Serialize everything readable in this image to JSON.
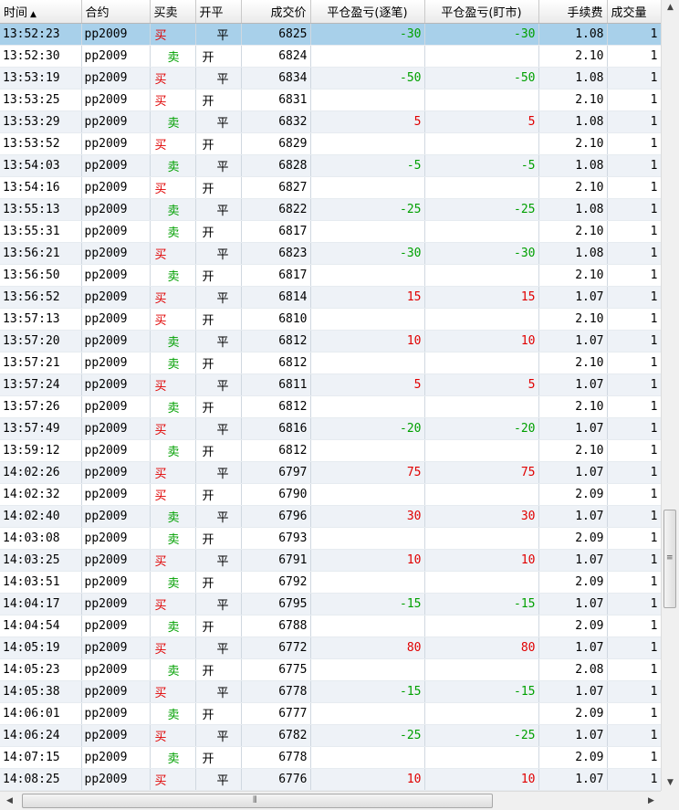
{
  "columns": [
    {
      "key": "time",
      "label": "时间",
      "sort_arrow": "▲",
      "align": "l"
    },
    {
      "key": "contract",
      "label": "合约",
      "align": "l"
    },
    {
      "key": "side",
      "label": "买卖",
      "align": "l"
    },
    {
      "key": "oc",
      "label": "开平",
      "align": "l"
    },
    {
      "key": "price",
      "label": "成交价",
      "align": "r"
    },
    {
      "key": "pnl_trade",
      "label": "平仓盈亏(逐笔)",
      "align": "c"
    },
    {
      "key": "pnl_mark",
      "label": "平仓盈亏(盯市)",
      "align": "c"
    },
    {
      "key": "fee",
      "label": "手续费",
      "align": "r"
    },
    {
      "key": "volume",
      "label": "成交量",
      "align": "l"
    }
  ],
  "colors": {
    "buy": "#e00000",
    "sell": "#00a000",
    "selected_row": "#a8d0ea"
  },
  "icons": {
    "sort": "sort-ascending-icon",
    "scroll_up": "arrow-up-icon",
    "scroll_down": "arrow-down-icon",
    "scroll_left": "arrow-left-icon",
    "scroll_right": "arrow-right-icon"
  },
  "scrollbar_glyphs": {
    "up": "▲",
    "down": "▼",
    "left": "◀",
    "right": "▶",
    "v_grip": "≡",
    "h_grip": "⦀"
  },
  "selected_index": 0,
  "rows": [
    {
      "time": "13:52:23",
      "contract": "pp2009",
      "side": "买",
      "oc": "平",
      "price": "6825",
      "pnl_trade": "-30",
      "pnl_mark": "-30",
      "fee": "1.08",
      "volume": "1"
    },
    {
      "time": "13:52:30",
      "contract": "pp2009",
      "side": "卖",
      "oc": "开",
      "price": "6824",
      "pnl_trade": "",
      "pnl_mark": "",
      "fee": "2.10",
      "volume": "1"
    },
    {
      "time": "13:53:19",
      "contract": "pp2009",
      "side": "买",
      "oc": "平",
      "price": "6834",
      "pnl_trade": "-50",
      "pnl_mark": "-50",
      "fee": "1.08",
      "volume": "1"
    },
    {
      "time": "13:53:25",
      "contract": "pp2009",
      "side": "买",
      "oc": "开",
      "price": "6831",
      "pnl_trade": "",
      "pnl_mark": "",
      "fee": "2.10",
      "volume": "1"
    },
    {
      "time": "13:53:29",
      "contract": "pp2009",
      "side": "卖",
      "oc": "平",
      "price": "6832",
      "pnl_trade": "5",
      "pnl_mark": "5",
      "fee": "1.08",
      "volume": "1"
    },
    {
      "time": "13:53:52",
      "contract": "pp2009",
      "side": "买",
      "oc": "开",
      "price": "6829",
      "pnl_trade": "",
      "pnl_mark": "",
      "fee": "2.10",
      "volume": "1"
    },
    {
      "time": "13:54:03",
      "contract": "pp2009",
      "side": "卖",
      "oc": "平",
      "price": "6828",
      "pnl_trade": "-5",
      "pnl_mark": "-5",
      "fee": "1.08",
      "volume": "1"
    },
    {
      "time": "13:54:16",
      "contract": "pp2009",
      "side": "买",
      "oc": "开",
      "price": "6827",
      "pnl_trade": "",
      "pnl_mark": "",
      "fee": "2.10",
      "volume": "1"
    },
    {
      "time": "13:55:13",
      "contract": "pp2009",
      "side": "卖",
      "oc": "平",
      "price": "6822",
      "pnl_trade": "-25",
      "pnl_mark": "-25",
      "fee": "1.08",
      "volume": "1"
    },
    {
      "time": "13:55:31",
      "contract": "pp2009",
      "side": "卖",
      "oc": "开",
      "price": "6817",
      "pnl_trade": "",
      "pnl_mark": "",
      "fee": "2.10",
      "volume": "1"
    },
    {
      "time": "13:56:21",
      "contract": "pp2009",
      "side": "买",
      "oc": "平",
      "price": "6823",
      "pnl_trade": "-30",
      "pnl_mark": "-30",
      "fee": "1.08",
      "volume": "1"
    },
    {
      "time": "13:56:50",
      "contract": "pp2009",
      "side": "卖",
      "oc": "开",
      "price": "6817",
      "pnl_trade": "",
      "pnl_mark": "",
      "fee": "2.10",
      "volume": "1"
    },
    {
      "time": "13:56:52",
      "contract": "pp2009",
      "side": "买",
      "oc": "平",
      "price": "6814",
      "pnl_trade": "15",
      "pnl_mark": "15",
      "fee": "1.07",
      "volume": "1"
    },
    {
      "time": "13:57:13",
      "contract": "pp2009",
      "side": "买",
      "oc": "开",
      "price": "6810",
      "pnl_trade": "",
      "pnl_mark": "",
      "fee": "2.10",
      "volume": "1"
    },
    {
      "time": "13:57:20",
      "contract": "pp2009",
      "side": "卖",
      "oc": "平",
      "price": "6812",
      "pnl_trade": "10",
      "pnl_mark": "10",
      "fee": "1.07",
      "volume": "1"
    },
    {
      "time": "13:57:21",
      "contract": "pp2009",
      "side": "卖",
      "oc": "开",
      "price": "6812",
      "pnl_trade": "",
      "pnl_mark": "",
      "fee": "2.10",
      "volume": "1"
    },
    {
      "time": "13:57:24",
      "contract": "pp2009",
      "side": "买",
      "oc": "平",
      "price": "6811",
      "pnl_trade": "5",
      "pnl_mark": "5",
      "fee": "1.07",
      "volume": "1"
    },
    {
      "time": "13:57:26",
      "contract": "pp2009",
      "side": "卖",
      "oc": "开",
      "price": "6812",
      "pnl_trade": "",
      "pnl_mark": "",
      "fee": "2.10",
      "volume": "1"
    },
    {
      "time": "13:57:49",
      "contract": "pp2009",
      "side": "买",
      "oc": "平",
      "price": "6816",
      "pnl_trade": "-20",
      "pnl_mark": "-20",
      "fee": "1.07",
      "volume": "1"
    },
    {
      "time": "13:59:12",
      "contract": "pp2009",
      "side": "卖",
      "oc": "开",
      "price": "6812",
      "pnl_trade": "",
      "pnl_mark": "",
      "fee": "2.10",
      "volume": "1"
    },
    {
      "time": "14:02:26",
      "contract": "pp2009",
      "side": "买",
      "oc": "平",
      "price": "6797",
      "pnl_trade": "75",
      "pnl_mark": "75",
      "fee": "1.07",
      "volume": "1"
    },
    {
      "time": "14:02:32",
      "contract": "pp2009",
      "side": "买",
      "oc": "开",
      "price": "6790",
      "pnl_trade": "",
      "pnl_mark": "",
      "fee": "2.09",
      "volume": "1"
    },
    {
      "time": "14:02:40",
      "contract": "pp2009",
      "side": "卖",
      "oc": "平",
      "price": "6796",
      "pnl_trade": "30",
      "pnl_mark": "30",
      "fee": "1.07",
      "volume": "1"
    },
    {
      "time": "14:03:08",
      "contract": "pp2009",
      "side": "卖",
      "oc": "开",
      "price": "6793",
      "pnl_trade": "",
      "pnl_mark": "",
      "fee": "2.09",
      "volume": "1"
    },
    {
      "time": "14:03:25",
      "contract": "pp2009",
      "side": "买",
      "oc": "平",
      "price": "6791",
      "pnl_trade": "10",
      "pnl_mark": "10",
      "fee": "1.07",
      "volume": "1"
    },
    {
      "time": "14:03:51",
      "contract": "pp2009",
      "side": "卖",
      "oc": "开",
      "price": "6792",
      "pnl_trade": "",
      "pnl_mark": "",
      "fee": "2.09",
      "volume": "1"
    },
    {
      "time": "14:04:17",
      "contract": "pp2009",
      "side": "买",
      "oc": "平",
      "price": "6795",
      "pnl_trade": "-15",
      "pnl_mark": "-15",
      "fee": "1.07",
      "volume": "1"
    },
    {
      "time": "14:04:54",
      "contract": "pp2009",
      "side": "卖",
      "oc": "开",
      "price": "6788",
      "pnl_trade": "",
      "pnl_mark": "",
      "fee": "2.09",
      "volume": "1"
    },
    {
      "time": "14:05:19",
      "contract": "pp2009",
      "side": "买",
      "oc": "平",
      "price": "6772",
      "pnl_trade": "80",
      "pnl_mark": "80",
      "fee": "1.07",
      "volume": "1"
    },
    {
      "time": "14:05:23",
      "contract": "pp2009",
      "side": "卖",
      "oc": "开",
      "price": "6775",
      "pnl_trade": "",
      "pnl_mark": "",
      "fee": "2.08",
      "volume": "1"
    },
    {
      "time": "14:05:38",
      "contract": "pp2009",
      "side": "买",
      "oc": "平",
      "price": "6778",
      "pnl_trade": "-15",
      "pnl_mark": "-15",
      "fee": "1.07",
      "volume": "1"
    },
    {
      "time": "14:06:01",
      "contract": "pp2009",
      "side": "卖",
      "oc": "开",
      "price": "6777",
      "pnl_trade": "",
      "pnl_mark": "",
      "fee": "2.09",
      "volume": "1"
    },
    {
      "time": "14:06:24",
      "contract": "pp2009",
      "side": "买",
      "oc": "平",
      "price": "6782",
      "pnl_trade": "-25",
      "pnl_mark": "-25",
      "fee": "1.07",
      "volume": "1"
    },
    {
      "time": "14:07:15",
      "contract": "pp2009",
      "side": "卖",
      "oc": "开",
      "price": "6778",
      "pnl_trade": "",
      "pnl_mark": "",
      "fee": "2.09",
      "volume": "1"
    },
    {
      "time": "14:08:25",
      "contract": "pp2009",
      "side": "买",
      "oc": "平",
      "price": "6776",
      "pnl_trade": "10",
      "pnl_mark": "10",
      "fee": "1.07",
      "volume": "1"
    }
  ]
}
